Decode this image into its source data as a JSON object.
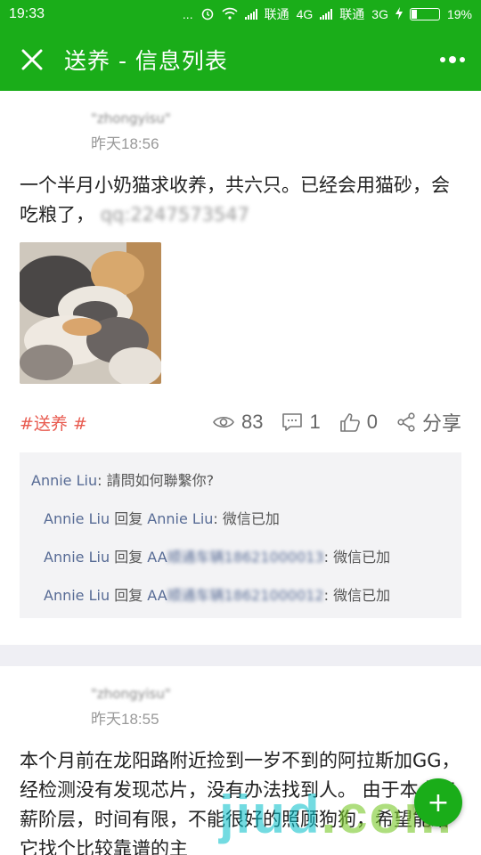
{
  "status_bar": {
    "time": "19:33",
    "dots": "...",
    "carrier1": "联通",
    "net1": "4G",
    "carrier2": "联通",
    "net2": "3G",
    "battery": "19%"
  },
  "nav": {
    "title": "送养 - 信息列表",
    "colors": {
      "bar": "#1aad19"
    }
  },
  "posts": [
    {
      "author": "\"zhongyisu\"",
      "date": "昨天18:56",
      "text": "一个半月小奶猫求收养，共六只。已经会用猫砂，会吃粮了，",
      "text_blurred": "qq:2247573547",
      "tag": "#送养 #",
      "views": "83",
      "comments_count": "1",
      "likes": "0",
      "share": "分享",
      "comments": [
        {
          "name": "Annie Liu",
          "sep": ": ",
          "text": "請問如何聯繫你?"
        },
        {
          "name": "Annie Liu",
          "verb": " 回复 ",
          "target": "Annie Liu",
          "sep": ": ",
          "text": "微信已加"
        },
        {
          "name": "Annie Liu",
          "verb": " 回复 ",
          "target": "AA",
          "target_blur": "顺通车辆18621000013",
          "sep": ": ",
          "text": "微信已加"
        },
        {
          "name": "Annie Liu",
          "verb": " 回复 ",
          "target": "AA",
          "target_blur": "顺通车辆18621000012",
          "sep": ": ",
          "text": "微信已加"
        }
      ]
    },
    {
      "author": "\"zhongyisu\"",
      "date": "昨天18:55",
      "text": "本个月前在龙阳路附近捡到一岁不到的阿拉斯加GG，经检测没有发现芯片，没有办法找到人。 由于本人工薪阶层，时间有限，不能很好的照顾狗狗，希望能给它找个比较靠谱的主"
    }
  ],
  "watermark": {
    "a": "jiud",
    "b": ".com"
  },
  "fab_label": "+"
}
